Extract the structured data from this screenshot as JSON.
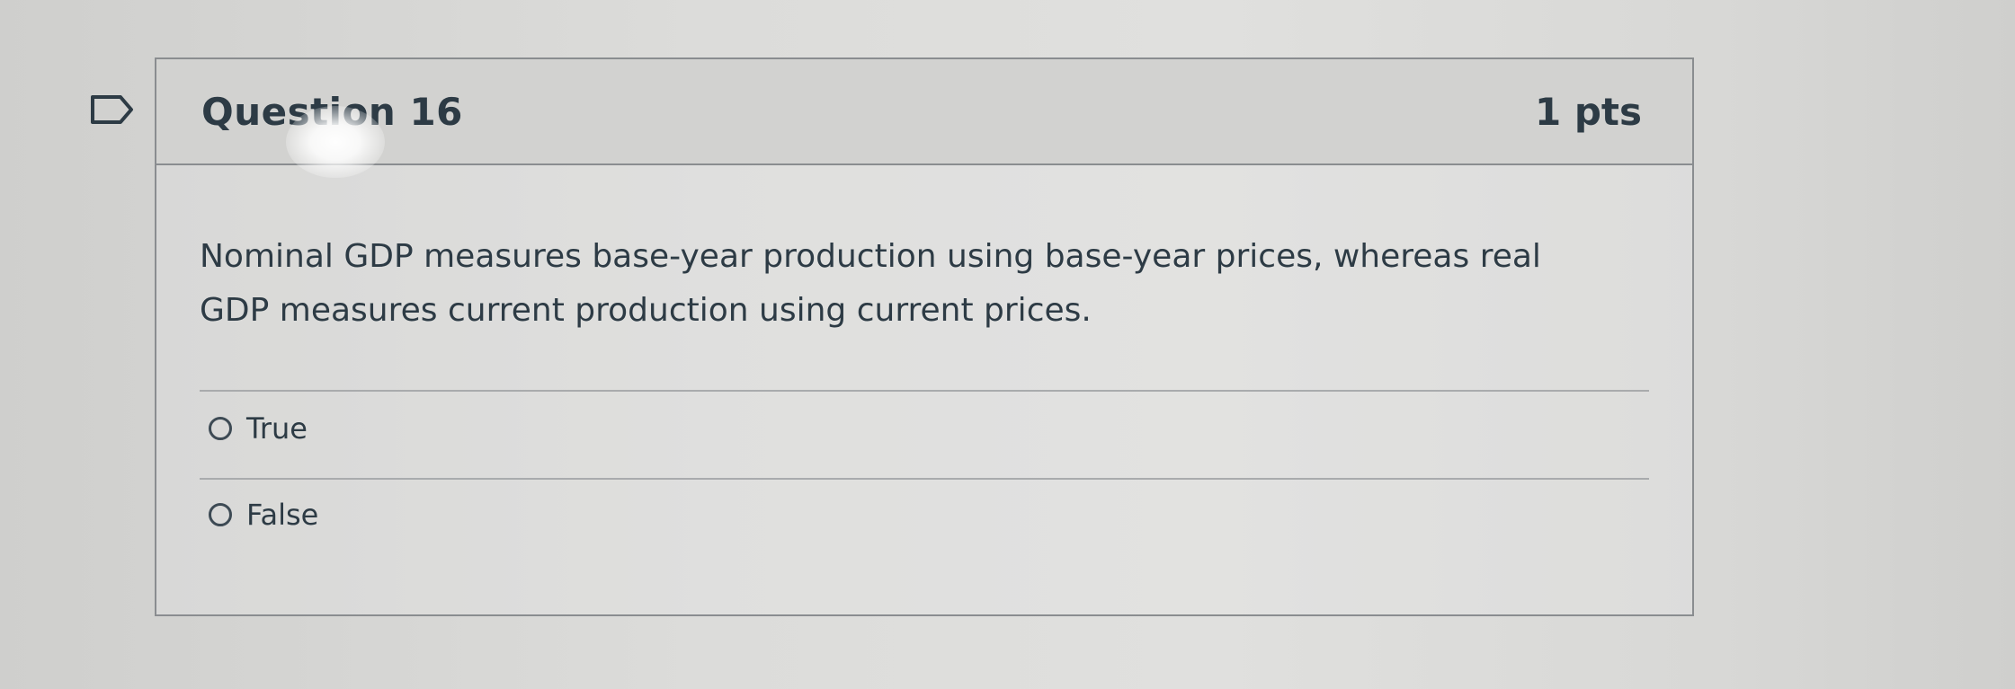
{
  "question": {
    "title": "Question 16",
    "points": "1 pts",
    "text": "Nominal GDP measures base-year production using base-year prices, whereas real GDP measures current production using current prices.",
    "answers": [
      {
        "label": "True"
      },
      {
        "label": "False"
      }
    ]
  },
  "icons": {
    "flag": "flag-icon",
    "radio": "radio-button-icon"
  },
  "colors": {
    "text": "#2d3b45",
    "border": "#8a8d90",
    "header_bg": "#d2d2d0"
  }
}
